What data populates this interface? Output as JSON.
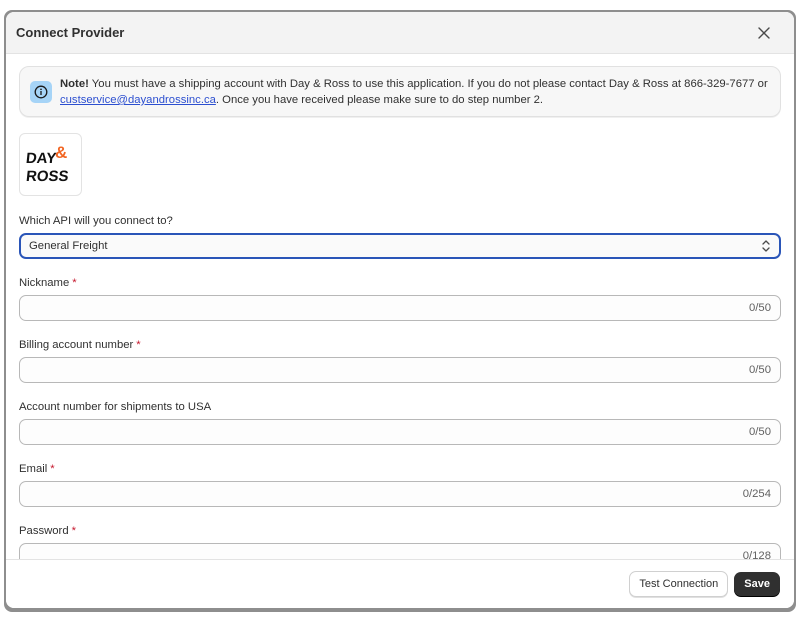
{
  "modal": {
    "title": "Connect Provider"
  },
  "banner": {
    "note_label": "Note!",
    "text_before_link": " You must have a shipping account with Day & Ross to use this application. If you do not please contact Day & Ross at 866-329-7677 or ",
    "email_link": "custservice@dayandrossinc.ca",
    "text_after_link": ". Once you have received please make sure to do step number 2."
  },
  "logo": {
    "text": "DAY & ROSS"
  },
  "api_select": {
    "label": "Which API will you connect to?",
    "value": "General Freight"
  },
  "fields": {
    "nickname": {
      "label": "Nickname",
      "counter": "0/50",
      "required": true
    },
    "billing": {
      "label": "Billing account number",
      "counter": "0/50",
      "required": true
    },
    "usa_account": {
      "label": "Account number for shipments to USA",
      "counter": "0/50",
      "required": false
    },
    "email": {
      "label": "Email",
      "counter": "0/254",
      "required": true
    },
    "password": {
      "label": "Password",
      "counter": "0/128",
      "required": true
    }
  },
  "required_mark": "*",
  "footer": {
    "test_label": "Test Connection",
    "save_label": "Save"
  },
  "colors": {
    "accent": "#2a55b8",
    "primary_button": "#303030",
    "required": "#c5162c",
    "info_icon_bg": "#a6d4f7",
    "logo_orange": "#f26522"
  }
}
